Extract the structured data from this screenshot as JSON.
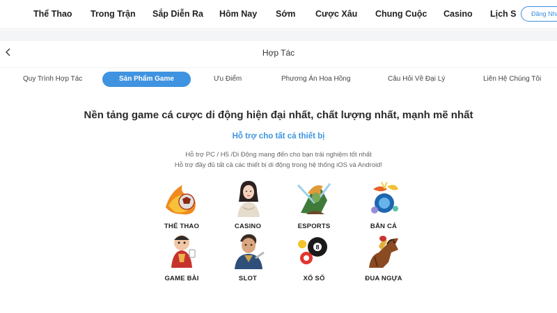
{
  "nav": {
    "items": [
      "Thể Thao",
      "Trong Trận",
      "Sắp Diễn Ra",
      "Hôm Nay",
      "Sớm",
      "Cược Xâu",
      "Chung Cuộc",
      "Casino",
      "Lịch S"
    ],
    "login_label": "Đăng Nhậ"
  },
  "header": {
    "title": "Hợp Tác"
  },
  "tabs": [
    {
      "label": "Quy Trình Hợp Tác"
    },
    {
      "label": "Sản Phẩm Game"
    },
    {
      "label": "Ưu Điểm"
    },
    {
      "label": "Phương Án Hoa Hồng"
    },
    {
      "label": "Câu Hỏi Về Đại Lý"
    },
    {
      "label": "Liên Hệ Chúng Tôi"
    }
  ],
  "main": {
    "headline": "Nền tảng game cá cược di động hiện đại nhất, chất lượng nhất, mạnh mẽ nhất",
    "subtitle": "Hỗ trợ cho tất cả thiết bị",
    "desc_line1": "Hỗ trợ PC / H5 /Di Động mang đến cho bạn trải nghiệm tốt nhất",
    "desc_line2": "Hỗ trợ đầy đủ tất cả các thiết bị di động trong hệ thống iOS và Android!"
  },
  "games": [
    {
      "label": "THỂ THAO",
      "icon": "fire-ball-icon"
    },
    {
      "label": "CASINO",
      "icon": "casino-dealer-icon"
    },
    {
      "label": "ESPORTS",
      "icon": "esports-warrior-icon"
    },
    {
      "label": "BẮN CÁ",
      "icon": "fish-shooting-icon"
    },
    {
      "label": "GAME BÀI",
      "icon": "card-game-character-icon"
    },
    {
      "label": "SLOT",
      "icon": "slot-character-icon"
    },
    {
      "label": "XỔ SỐ",
      "icon": "lottery-balls-icon"
    },
    {
      "label": "ĐUA NGỰA",
      "icon": "racing-horse-icon"
    }
  ],
  "colors": {
    "accent": "#3f93e0",
    "text": "#2a2a2a",
    "band": "#f4f5f7"
  }
}
